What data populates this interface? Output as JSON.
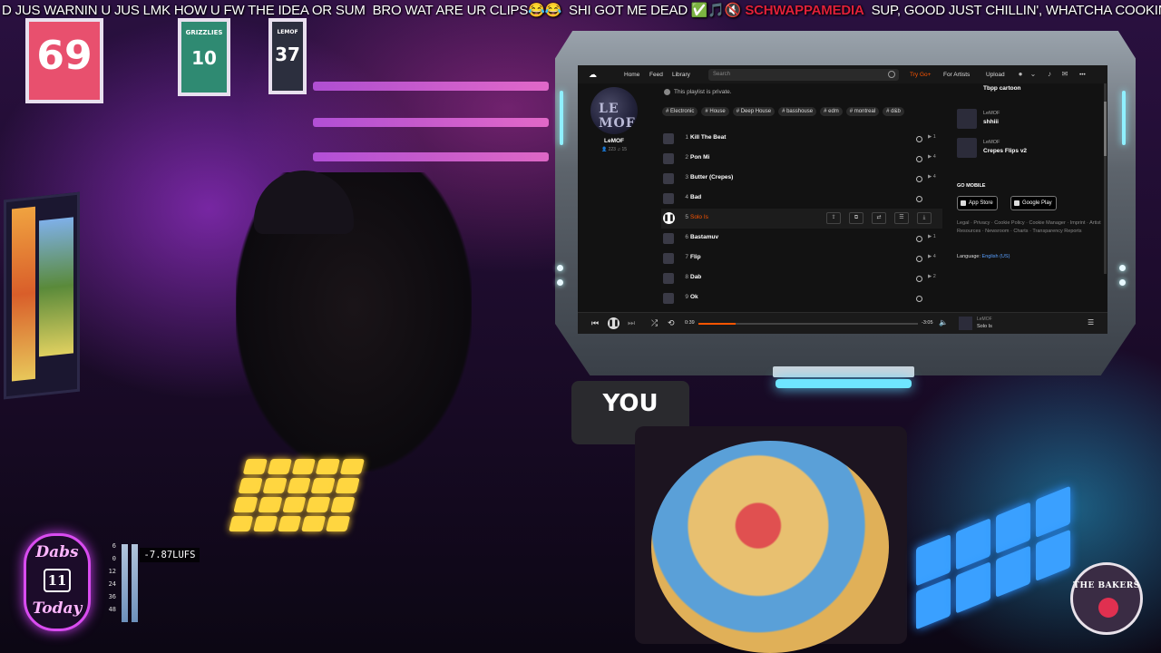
{
  "chat_ticker": {
    "message_1": "D JUS WARNIN U JUS LMK HOW U FW THE IDEA OR SUM",
    "message_2": "BRO WAT ARE UR CLIPS😂😂",
    "message_3": "SHI GOT ME DEAD ✅🎵🔇",
    "channel": "SCHWAPPAMEDIA",
    "message_4": "SUP, GOOD JUST CHILLIN', WHATCHA COOKING?"
  },
  "background": {
    "jersey_1": "69",
    "jersey_2": "GRIZZLIES",
    "jersey_2_num": "10",
    "jersey_3": "LEMOF",
    "jersey_3_num": "37",
    "hoodie_text": "YOU"
  },
  "browser": {
    "nav": {
      "home": "Home",
      "feed": "Feed",
      "library": "Library",
      "search_placeholder": "Search",
      "try_next": "Try Go+",
      "for_artists": "For Artists",
      "upload": "Upload",
      "more": "•••"
    },
    "artist": {
      "name": "LeMOF",
      "stats": "👤 223 ♫ 15",
      "artwork_text": "LE MOF"
    },
    "private_notice": "This playlist is private.",
    "tags": [
      "# Electronic",
      "# House",
      "# Deep House",
      "# basshouse",
      "# edm",
      "# montreal",
      "# d&b"
    ],
    "tracks": [
      {
        "num": "1",
        "title": "Kill The Beat",
        "plays": "▶ 1"
      },
      {
        "num": "2",
        "title": "Pon Mi",
        "plays": "▶ 4"
      },
      {
        "num": "3",
        "title": "Butter (Crepes)",
        "plays": "▶ 4"
      },
      {
        "num": "4",
        "title": "Bad",
        "plays": ""
      },
      {
        "num": "5",
        "title": "Solo Is",
        "plays": ""
      },
      {
        "num": "6",
        "title": "Bastamuv",
        "plays": "▶ 1"
      },
      {
        "num": "7",
        "title": "Flip",
        "plays": "▶ 4"
      },
      {
        "num": "8",
        "title": "Dab",
        "plays": "▶ 2"
      },
      {
        "num": "9",
        "title": "Ok",
        "plays": ""
      }
    ],
    "related": [
      {
        "artist": "",
        "title": "Tbpp cartoon"
      },
      {
        "artist": "LeMOF",
        "title": "shhiii"
      },
      {
        "artist": "LeMOF",
        "title": "Crepes Flips v2"
      }
    ],
    "go_mobile": "GO MOBILE",
    "app_store": "App Store",
    "google_play": "Google Play",
    "footer_links": "Legal · Privacy · Cookie Policy · Cookie Manager · Imprint · Artist Resources · Newsroom · Charts · Transparency Reports",
    "language_label": "Language:",
    "language_value": "English (US)",
    "player": {
      "elapsed": "0:39",
      "duration": "-3:05",
      "progress": 0.17,
      "artist": "LeMOF",
      "title": "Solo Is"
    }
  },
  "overlays": {
    "badge_top": "Dabs",
    "badge_mid": "11",
    "badge_bottom": "Today",
    "meter_scale": [
      "6",
      "0",
      "12",
      "24",
      "36",
      "48",
      "60"
    ],
    "lufs": "-7.87LUFS",
    "bakers_text": "THE BAKERS"
  },
  "colors": {
    "accent": "#ff5500",
    "chat_channel": "#e0203a",
    "badge_border": "#d94cf0",
    "link": "#5aa0ff"
  }
}
